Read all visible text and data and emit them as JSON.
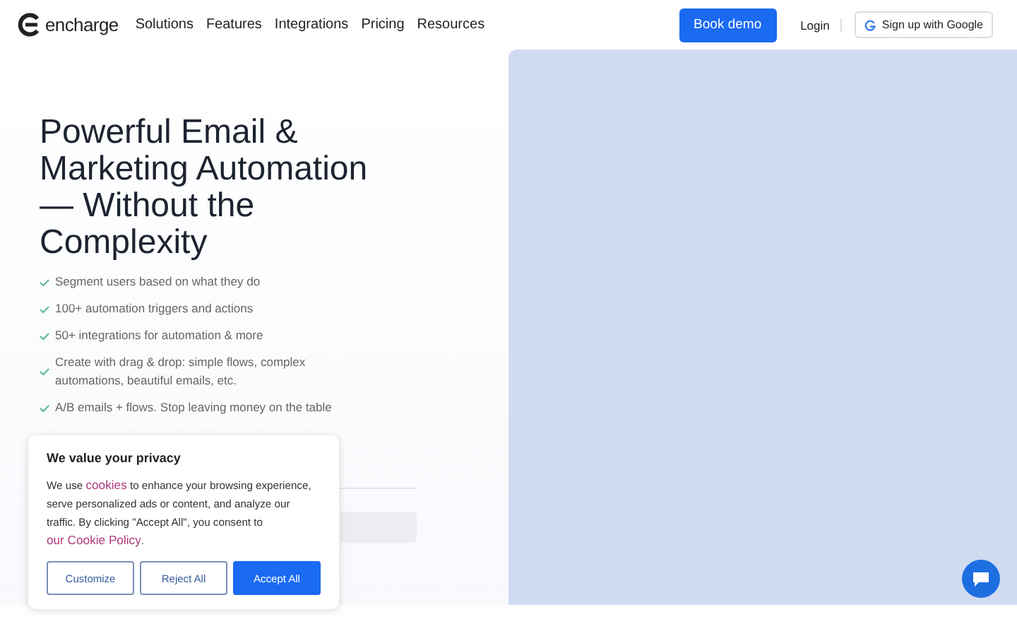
{
  "header": {
    "logo": "encharge",
    "nav": [
      "Solutions",
      "Features",
      "Integrations",
      "Pricing",
      "Resources"
    ],
    "book_demo": "Book demo",
    "login": "Login",
    "signup": "Sign up with Google"
  },
  "hero": {
    "title": "Powerful Email & Marketing Automation — Without the Complexity",
    "features": [
      "Segment users based on what they do",
      "100+ automation triggers and actions",
      "50+ integrations for automation & more",
      "Create with drag & drop: simple flows, complex automations, beautiful emails, etc.",
      "A/B emails + flows. Stop leaving money on the table"
    ]
  },
  "cookie_banner": {
    "title": "We value your privacy",
    "text_parts": [
      {
        "kind": "text",
        "text": "We use "
      },
      {
        "kind": "link",
        "text": "cookies"
      },
      {
        "kind": "text",
        "text": " to enhance your browsing experience, serve personalized ads or content, and analyze our traffic. By clicking \"Accept All\", you consent to "
      },
      {
        "kind": "link",
        "text": "our Cookie Policy"
      },
      {
        "kind": "text",
        "text": "."
      }
    ],
    "buttons": [
      {
        "label": "Customize",
        "kind": "outline"
      },
      {
        "label": "Reject All",
        "kind": "outline"
      },
      {
        "label": "Accept All",
        "kind": "primary"
      }
    ]
  }
}
